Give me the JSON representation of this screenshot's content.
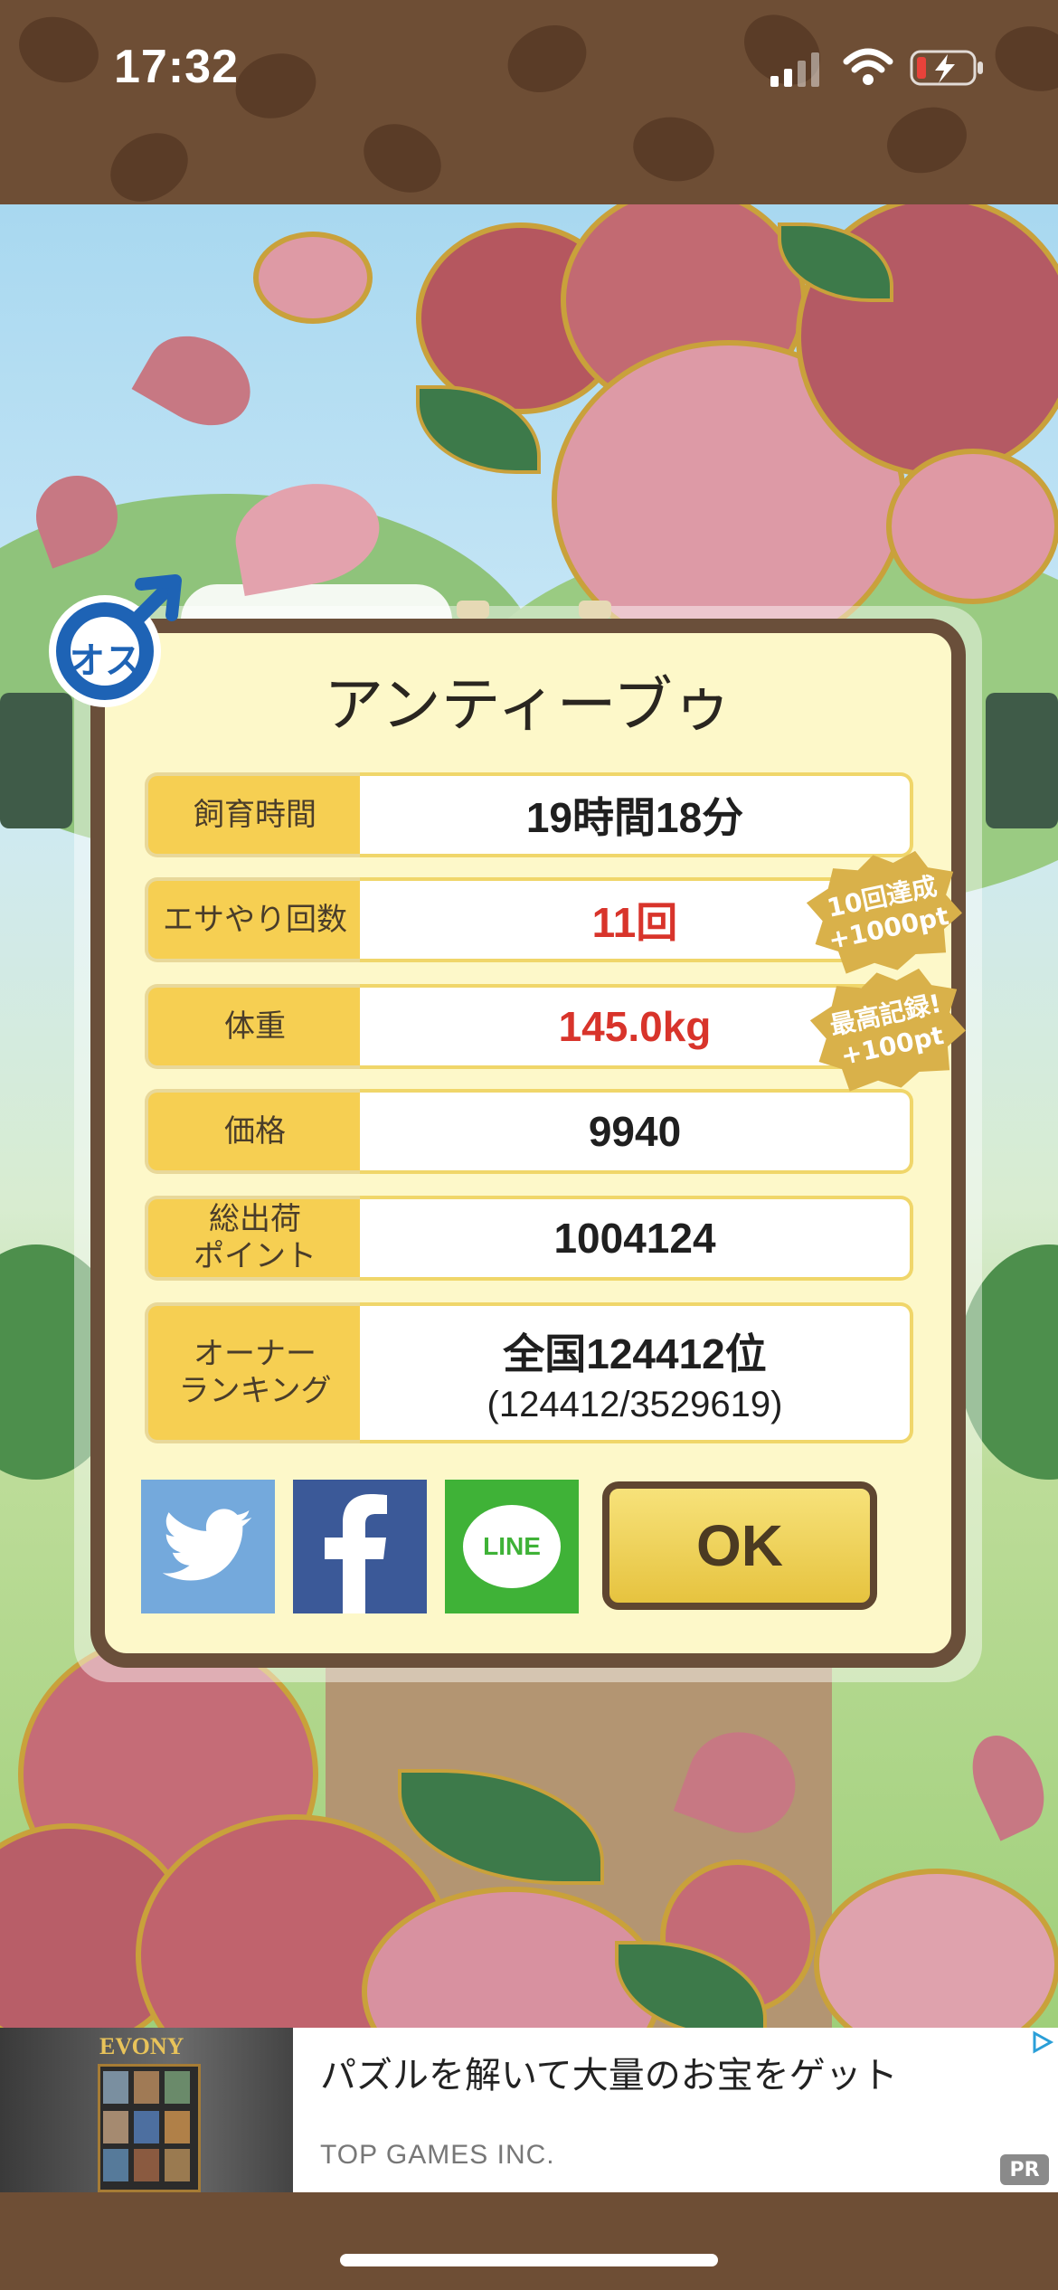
{
  "status_bar": {
    "time": "17:32"
  },
  "dialog": {
    "gender_badge": "オス",
    "pet_name": "アンティーブゥ",
    "rows": [
      {
        "label": "飼育時間",
        "value": "19時間18分",
        "highlight": false
      },
      {
        "label": "エサやり回数",
        "value": "11回",
        "highlight": true
      },
      {
        "label": "体重",
        "value": "145.0kg",
        "highlight": true
      },
      {
        "label": "価格",
        "value": "9940",
        "highlight": false
      },
      {
        "label": "総出荷\nポイント",
        "value": "1004124",
        "highlight": false
      },
      {
        "label": "オーナー\nランキング",
        "value": "全国124412位",
        "sub_value": "(124412/3529619)",
        "highlight": false
      }
    ],
    "bonus_badges": [
      {
        "text": "10回達成\n+1000pt"
      },
      {
        "text": "最高記録!\n+100pt"
      }
    ],
    "share_buttons": {
      "twitter": "twitter-icon",
      "facebook": "facebook-icon",
      "line": "LINE"
    },
    "ok_label": "OK"
  },
  "ad": {
    "image_brand": "EVONY",
    "headline": "パズルを解いて大量のお宝をゲット",
    "advertiser": "TOP GAMES INC.",
    "pr_label": "PR"
  },
  "colors": {
    "frame_brown": "#6a4f3a",
    "label_yellow": "#f6cf52",
    "highlight_red": "#d8342b",
    "twitter_blue": "#74a9dc",
    "facebook_blue": "#3b5998",
    "line_green": "#3fb237"
  }
}
